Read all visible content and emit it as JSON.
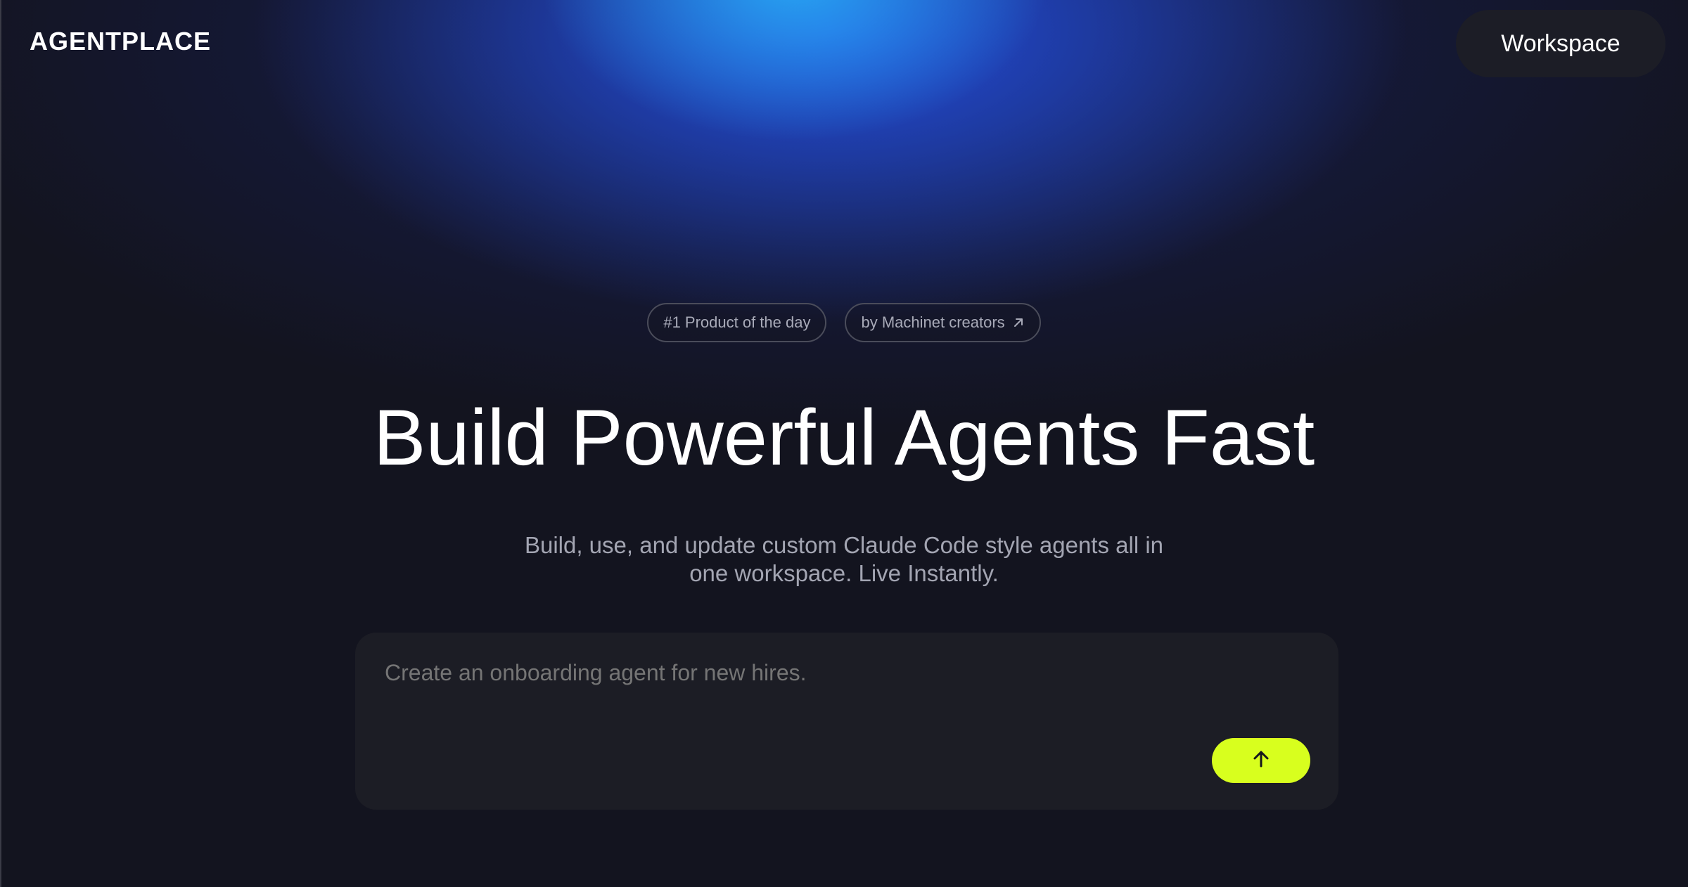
{
  "header": {
    "logo": "AGENTPLACE",
    "workspace_button": "Workspace"
  },
  "badges": {
    "product": "#1 Product of the day",
    "creators": "by Machinet creators"
  },
  "hero": {
    "title": "Build Powerful Agents Fast",
    "subtitle": "Build, use, and update custom Claude Code style agents all in one workspace. Live Instantly."
  },
  "prompt": {
    "placeholder": "Create an onboarding agent for new hires.",
    "send_icon": "arrow-up-icon"
  },
  "colors": {
    "background": "#13141f",
    "accent": "#d8ff1e",
    "glow": "#2350e1"
  }
}
